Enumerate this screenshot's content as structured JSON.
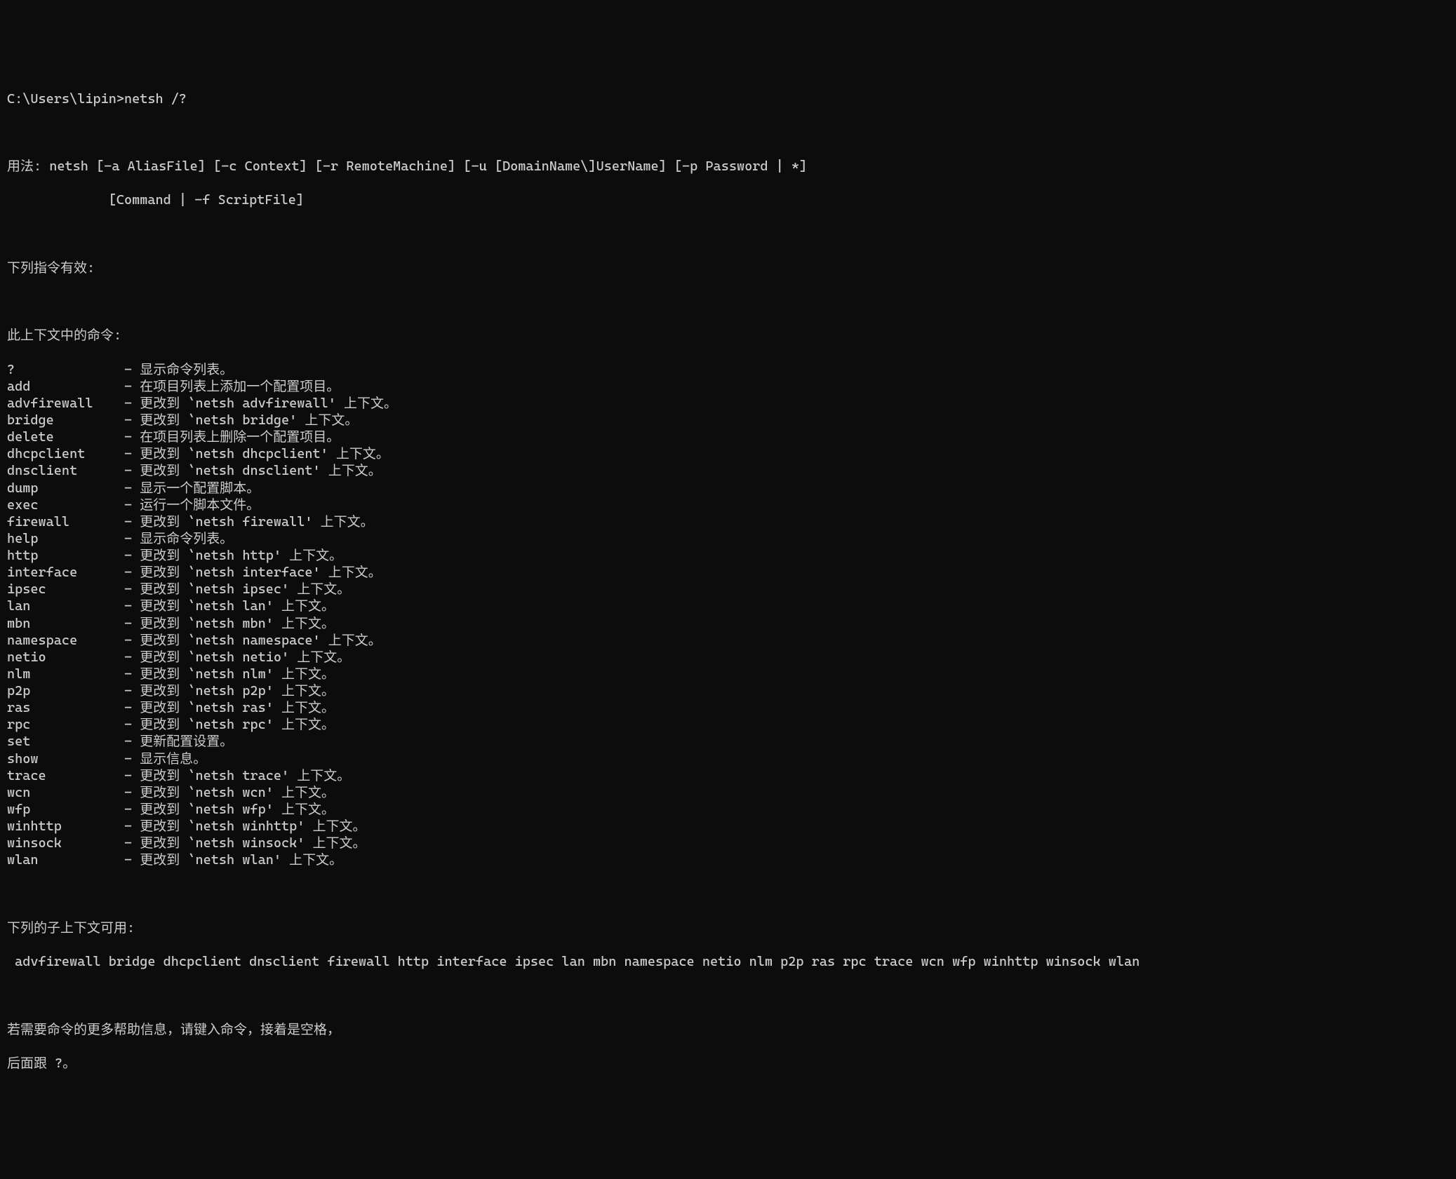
{
  "prompt": "C:\\Users\\lipin>netsh /?",
  "usage_line1": "用法: netsh [-a AliasFile] [-c Context] [-r RemoteMachine] [-u [DomainName\\]UserName] [-p Password | *]",
  "usage_line2": "             [Command | -f ScriptFile]",
  "valid_commands_header": "下列指令有效:",
  "context_commands_header": "此上下文中的命令:",
  "commands": [
    {
      "name": "?",
      "desc": "显示命令列表。"
    },
    {
      "name": "add",
      "desc": "在项目列表上添加一个配置项目。"
    },
    {
      "name": "advfirewall",
      "desc": "更改到 `netsh advfirewall' 上下文。"
    },
    {
      "name": "bridge",
      "desc": "更改到 `netsh bridge' 上下文。"
    },
    {
      "name": "delete",
      "desc": "在项目列表上删除一个配置项目。"
    },
    {
      "name": "dhcpclient",
      "desc": "更改到 `netsh dhcpclient' 上下文。"
    },
    {
      "name": "dnsclient",
      "desc": "更改到 `netsh dnsclient' 上下文。"
    },
    {
      "name": "dump",
      "desc": "显示一个配置脚本。"
    },
    {
      "name": "exec",
      "desc": "运行一个脚本文件。"
    },
    {
      "name": "firewall",
      "desc": "更改到 `netsh firewall' 上下文。"
    },
    {
      "name": "help",
      "desc": "显示命令列表。"
    },
    {
      "name": "http",
      "desc": "更改到 `netsh http' 上下文。"
    },
    {
      "name": "interface",
      "desc": "更改到 `netsh interface' 上下文。"
    },
    {
      "name": "ipsec",
      "desc": "更改到 `netsh ipsec' 上下文。"
    },
    {
      "name": "lan",
      "desc": "更改到 `netsh lan' 上下文。"
    },
    {
      "name": "mbn",
      "desc": "更改到 `netsh mbn' 上下文。"
    },
    {
      "name": "namespace",
      "desc": "更改到 `netsh namespace' 上下文。"
    },
    {
      "name": "netio",
      "desc": "更改到 `netsh netio' 上下文。"
    },
    {
      "name": "nlm",
      "desc": "更改到 `netsh nlm' 上下文。"
    },
    {
      "name": "p2p",
      "desc": "更改到 `netsh p2p' 上下文。"
    },
    {
      "name": "ras",
      "desc": "更改到 `netsh ras' 上下文。"
    },
    {
      "name": "rpc",
      "desc": "更改到 `netsh rpc' 上下文。"
    },
    {
      "name": "set",
      "desc": "更新配置设置。"
    },
    {
      "name": "show",
      "desc": "显示信息。"
    },
    {
      "name": "trace",
      "desc": "更改到 `netsh trace' 上下文。"
    },
    {
      "name": "wcn",
      "desc": "更改到 `netsh wcn' 上下文。"
    },
    {
      "name": "wfp",
      "desc": "更改到 `netsh wfp' 上下文。"
    },
    {
      "name": "winhttp",
      "desc": "更改到 `netsh winhttp' 上下文。"
    },
    {
      "name": "winsock",
      "desc": "更改到 `netsh winsock' 上下文。"
    },
    {
      "name": "wlan",
      "desc": "更改到 `netsh wlan' 上下文。"
    }
  ],
  "separator": "- ",
  "subcontexts_header": "下列的子上下文可用:",
  "subcontexts_list": " advfirewall bridge dhcpclient dnsclient firewall http interface ipsec lan mbn namespace netio nlm p2p ras rpc trace wcn wfp winhttp winsock wlan",
  "help_hint_line1": "若需要命令的更多帮助信息，请键入命令，接着是空格，",
  "help_hint_line2": "后面跟 ?。"
}
